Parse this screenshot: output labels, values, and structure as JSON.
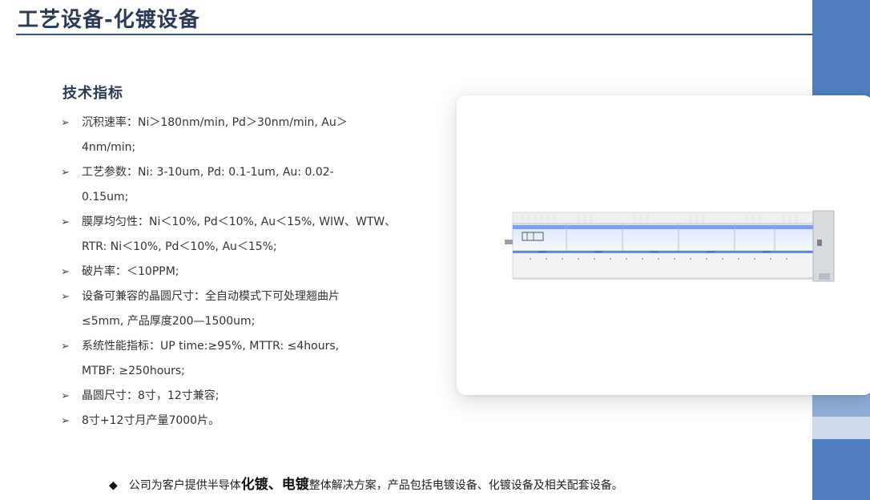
{
  "header": {
    "title": "工艺设备-化镀设备"
  },
  "specs": {
    "heading": "技术指标",
    "bullet": "➢",
    "items": [
      {
        "line1": "沉积速率：Ni＞180nm/min, Pd＞30nm/min, Au＞",
        "line2": "4nm/min;"
      },
      {
        "line1": "工艺参数：Ni: 3-10um, Pd: 0.1-1um, Au: 0.02-",
        "line2": "0.15um;"
      },
      {
        "line1": "膜厚均匀性：Ni＜10%, Pd＜10%, Au＜15%, WIW、WTW、",
        "line2": "RTR: Ni＜10%, Pd＜10%, Au＜15%;"
      },
      {
        "line1": "破片率：＜10PPM;",
        "line2": ""
      },
      {
        "line1": "设备可兼容的晶圆尺寸：全自动模式下可处理翘曲片",
        "line2": "≤5mm, 产品厚度200—1500um;"
      },
      {
        "line1": "系统性能指标：UP time:≥95%, MTTR: ≤4hours,",
        "line2": "MTBF: ≥250hours;"
      },
      {
        "line1": "晶圆尺寸：8寸，12寸兼容;",
        "line2": ""
      },
      {
        "line1": "8寸+12寸月产量7000片。",
        "line2": ""
      }
    ]
  },
  "footer": {
    "bullet": "◆",
    "prefix": "公司为客户提供半导体",
    "emph1": "化镀",
    "sep": "、",
    "emph2": "电镀",
    "suffix": "整体解决方案，产品包括电镀设备、化镀设备及相关配套设备。"
  },
  "colors": {
    "title": "#2b3a55",
    "accent_bar": "#4f7fbf",
    "machine_glow": "#6e93e6"
  }
}
